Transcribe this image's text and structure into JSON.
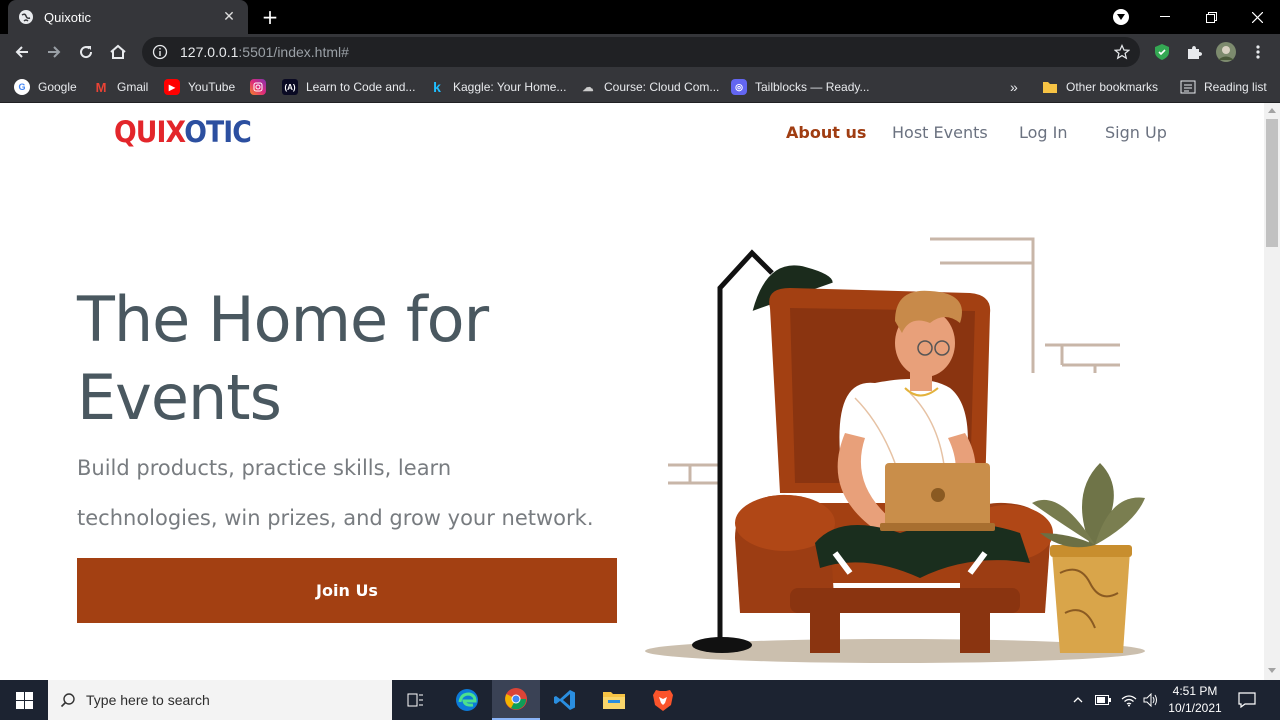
{
  "browser": {
    "tab_title": "Quixotic",
    "url_host": "127.0.0.1",
    "url_rest": ":5501/index.html#",
    "bookmarks": [
      {
        "label": "Google"
      },
      {
        "label": "Gmail"
      },
      {
        "label": "YouTube"
      },
      {
        "label": ""
      },
      {
        "label": "Learn to Code and..."
      },
      {
        "label": "Kaggle: Your Home..."
      },
      {
        "label": "Course: Cloud Com..."
      },
      {
        "label": "Tailblocks — Ready..."
      }
    ],
    "overflow_label": "»",
    "other_bookmarks": "Other bookmarks",
    "reading_list": "Reading list"
  },
  "page": {
    "logo": {
      "part1": "QUIX",
      "part2": "OTIC"
    },
    "nav": [
      {
        "label": "About us"
      },
      {
        "label": "Host Events"
      },
      {
        "label": "Log In"
      },
      {
        "label": "Sign Up"
      }
    ],
    "hero": {
      "title_line1": "The Home for",
      "title_line2": "Events",
      "subtitle_line1": "Build products, practice skills, learn",
      "subtitle_line2": "technologies, win prizes, and grow your network.",
      "cta": "Join Us"
    },
    "colors": {
      "accent": "#a34012",
      "logo_red": "#e3262b",
      "logo_blue": "#2c4fa0",
      "heading": "#4a5860"
    }
  },
  "taskbar": {
    "search_placeholder": "Type here to search",
    "time": "4:51 PM",
    "date": "10/1/2021"
  }
}
